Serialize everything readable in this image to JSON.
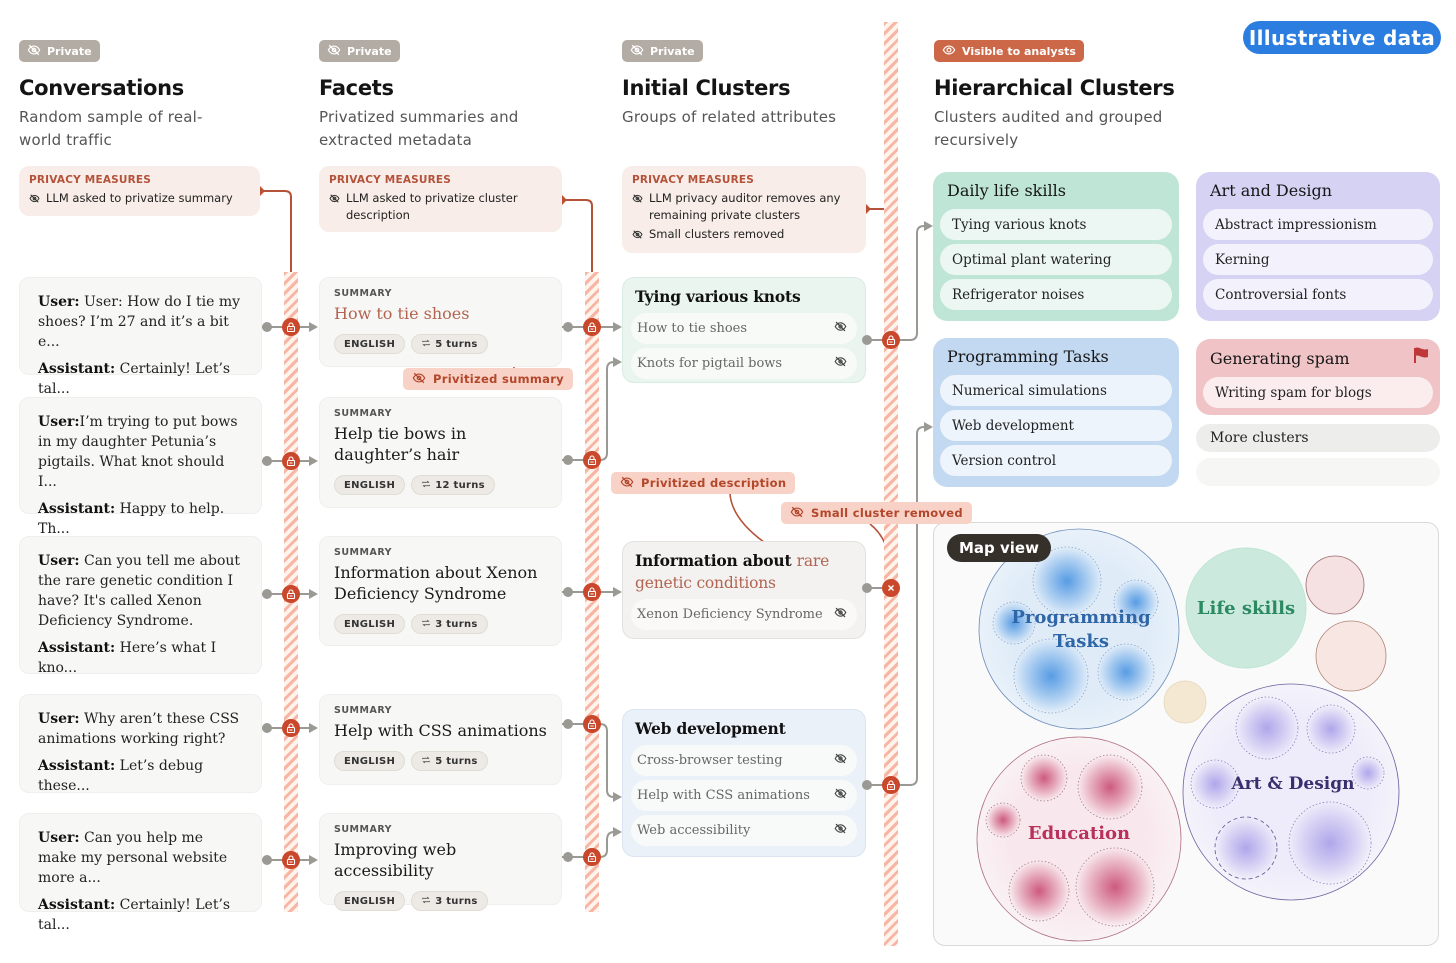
{
  "illustrative_badge": "Illustrative data",
  "columns": [
    {
      "badge": "Private",
      "badge_icon": "eye-off-icon",
      "title": "Conversations",
      "subtitle_lines": [
        "Random sample of real-",
        "world traffic"
      ]
    },
    {
      "badge": "Private",
      "badge_icon": "eye-off-icon",
      "title": "Facets",
      "subtitle_lines": [
        "Privatized summaries and",
        "extracted metadata"
      ]
    },
    {
      "badge": "Private",
      "badge_icon": "eye-off-icon",
      "title": "Initial Clusters",
      "subtitle_lines": [
        "Groups of related attributes"
      ]
    },
    {
      "badge": "Visible to analysts",
      "badge_icon": "eye-icon",
      "title": "Hierarchical Clusters",
      "subtitle_lines": [
        "Clusters audited and grouped",
        "recursively"
      ]
    }
  ],
  "privacy_measures": [
    {
      "heading": "PRIVACY MEASURES",
      "items": [
        "LLM asked to privatize summary"
      ]
    },
    {
      "heading": "PRIVACY MEASURES",
      "items": [
        "LLM asked to privatize cluster description"
      ]
    },
    {
      "heading": "PRIVACY MEASURES",
      "items": [
        "LLM privacy auditor removes any remaining private clusters",
        "Small clusters removed"
      ]
    }
  ],
  "conversations": [
    {
      "user_label": "User:",
      "user_text": " User: How do I tie my shoes? I’m 27 and it’s a bit e...",
      "assistant_label": "Assistant:",
      "assistant_text": "Certainly! Let’s tal..."
    },
    {
      "user_label": "User:",
      "user_text": "I’m trying to put bows in my daughter Petunia’s pigtails. What knot should I...",
      "assistant_label": "Assistant:",
      "assistant_text": "Happy to help. Th..."
    },
    {
      "user_label": "User:",
      "user_text": " Can you tell me about the rare genetic condition I have? It's called Xenon Deficiency Syndrome.",
      "assistant_label": "Assistant:",
      "assistant_text": "Here’s what I kno..."
    },
    {
      "user_label": "User:",
      "user_text": " Why aren’t these CSS animations working right?",
      "assistant_label": "Assistant:",
      "assistant_text": "Let’s debug these..."
    },
    {
      "user_label": "User:",
      "user_text": " Can you help me make my personal website more a...",
      "assistant_label": "Assistant:",
      "assistant_text": "Certainly! Let’s tal..."
    }
  ],
  "facets": [
    {
      "label": "SUMMARY",
      "title": "How to tie shoes",
      "language": "ENGLISH",
      "turns": "5 turns",
      "highlighted": true
    },
    {
      "label": "SUMMARY",
      "title": "Help tie bows in daughter’s hair",
      "language": "ENGLISH",
      "turns": "12 turns",
      "highlighted": false
    },
    {
      "label": "SUMMARY",
      "title": "Information about Xenon Deficiency Syndrome",
      "language": "ENGLISH",
      "turns": "3 turns",
      "highlighted": false
    },
    {
      "label": "SUMMARY",
      "title": "Help with CSS animations",
      "language": "ENGLISH",
      "turns": "5 turns",
      "highlighted": false
    },
    {
      "label": "SUMMARY",
      "title": "Improving web accessibility",
      "language": "ENGLISH",
      "turns": "3 turns",
      "highlighted": false
    }
  ],
  "initial_clusters": [
    {
      "title": "Tying various knots",
      "items": [
        "How to tie shoes",
        "Knots for pigtail bows"
      ],
      "color": "#e8f4ef"
    },
    {
      "title_plain": "Information about ",
      "title_highlight": "rare genetic conditions",
      "items": [
        "Xenon Deficiency Syndrome"
      ],
      "color": "#f1f0ee",
      "removed": true
    },
    {
      "title": "Web development",
      "items": [
        "Cross-browser testing",
        "Help with CSS animations",
        "Web accessibility"
      ],
      "color": "#e9eff8"
    }
  ],
  "callouts": {
    "privatized_summary": "Privitized summary",
    "privatized_description": "Privitized description",
    "small_cluster_removed": "Small cluster removed"
  },
  "hierarchical_clusters": [
    {
      "title": "Daily life skills",
      "items": [
        "Tying various knots",
        "Optimal plant watering",
        "Refrigerator noises"
      ],
      "color": "#bfe5d6"
    },
    {
      "title": "Art and Design",
      "items": [
        "Abstract impressionism",
        "Kerning",
        "Controversial fonts"
      ],
      "color": "#d5d2f3"
    },
    {
      "title": "Programming Tasks",
      "items": [
        "Numerical simulations",
        "Web development",
        "Version control"
      ],
      "color": "#c3d9f1"
    },
    {
      "title": "Generating spam",
      "items": [
        "Writing spam for blogs"
      ],
      "color": "#f0c4c6",
      "flagged": true,
      "flag_color": "#c0373a"
    }
  ],
  "more_clusters": "More clusters",
  "map": {
    "label": "Map view",
    "bubbles": [
      {
        "name": "Programming Tasks",
        "color": "#3f84d4",
        "text_color": "#2f66a8"
      },
      {
        "name": "Life skills",
        "color": "#bfe5d6",
        "text_color": "#2c8a63"
      },
      {
        "name": "Education",
        "color": "#c94a72",
        "text_color": "#b8325c"
      },
      {
        "name": "Art & Design",
        "color": "#9b8fe5",
        "text_color": "#3a2e6e"
      }
    ]
  }
}
